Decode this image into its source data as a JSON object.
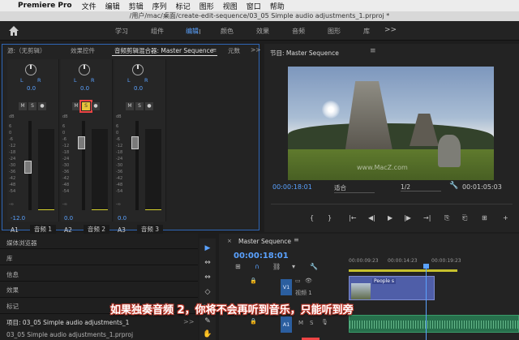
{
  "menubar": {
    "app_name": "Premiere Pro",
    "items": [
      "文件",
      "编辑",
      "剪辑",
      "序列",
      "标记",
      "图形",
      "视图",
      "窗口",
      "帮助"
    ]
  },
  "titlebar": {
    "path": "/用户/mac/桌面/create-edit-sequence/03_05 Simple audio adjustments_1.prproj *"
  },
  "workspace": {
    "tabs": [
      "学习",
      "组件",
      "编辑",
      "颜色",
      "效果",
      "音频",
      "图形",
      "库"
    ],
    "active_tab": "编辑",
    "more": ">>"
  },
  "mixer_panel": {
    "tabs": {
      "source": "源:（无剪辑）",
      "effects": "效果控件",
      "mixer": "音频剪辑混合器: Master Sequence",
      "meta": "元数",
      "more": ">>"
    },
    "channels": [
      {
        "track": "A1",
        "name": "音频 1",
        "pan": "0.0",
        "gain": "-12.0",
        "pan_l": "L",
        "pan_r": "R",
        "mute": "M",
        "solo": "S",
        "rec": "●",
        "solo_on": false,
        "fader_level": 0.48
      },
      {
        "track": "A2",
        "name": "音频 2",
        "pan": "0.0",
        "gain": "0.0",
        "pan_l": "L",
        "pan_r": "R",
        "mute": "M",
        "solo": "S",
        "rec": "●",
        "solo_on": true,
        "fader_level": 0.8
      },
      {
        "track": "A3",
        "name": "音频 3",
        "pan": "0.0",
        "gain": "0.0",
        "pan_l": "L",
        "pan_r": "R",
        "mute": "M",
        "solo": "S",
        "rec": "●",
        "solo_on": false,
        "fader_level": 0.8
      }
    ],
    "db_scale": [
      "dB",
      "6",
      "0",
      "-6",
      "-12",
      "-18",
      "-24",
      "-30",
      "-36",
      "-42",
      "-48",
      "-54",
      "-∞"
    ]
  },
  "program_monitor": {
    "title": "节目: Master Sequence",
    "menu_icon": "≡",
    "timecode": "00:00:18:01",
    "fit": "适合",
    "resolution": "1/2",
    "duration": "00:01:05:03",
    "watermark": "www.MacZ.com",
    "controls": [
      "{",
      "}",
      "|←",
      "◀|",
      "▶",
      "|▶",
      "→|",
      "⎘",
      "⎗",
      "⊞",
      "+"
    ]
  },
  "project_panel": {
    "items": [
      "媒体浏览器",
      "库",
      "信息",
      "效果",
      "标记"
    ],
    "project_title": "项目: 03_05 Simple audio adjustments_1",
    "file": "03_05 Simple audio adjustments_1.prproj",
    "more": ">>"
  },
  "tools": [
    "▶",
    "⇔",
    "⇔",
    "◇",
    "⟷",
    "✎",
    "✋"
  ],
  "timeline": {
    "title": "Master Sequence",
    "close": "×",
    "menu_icon": "≡",
    "timecode": "00:00:18:01",
    "ruler": [
      "00:00:09:23",
      "00:00:14:23",
      "00:00:19:23"
    ],
    "v1": {
      "target": "V1",
      "label": "视频 1",
      "clip": "People s"
    },
    "a1": {
      "target": "A1",
      "mute": "M",
      "solo": "S",
      "mic": "🎙"
    }
  },
  "subtitle": "如果独奏音频 2，你将不会再听到音乐，只能听到旁"
}
